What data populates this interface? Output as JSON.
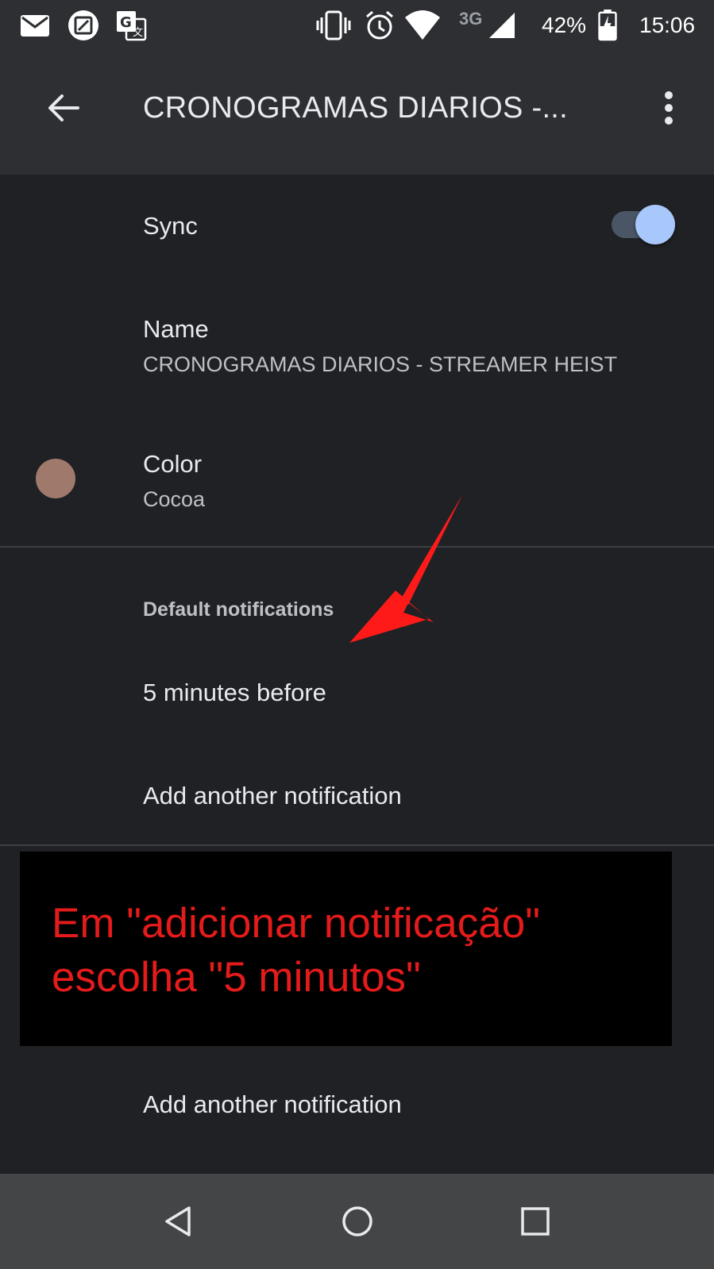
{
  "status_bar": {
    "icons": [
      "mail-icon",
      "screenshot-icon",
      "translate-icon",
      "vibrate-icon",
      "alarm-icon",
      "wifi-icon",
      "signal-icon",
      "battery-charging-icon"
    ],
    "network": "3G",
    "battery": "42%",
    "time": "15:06"
  },
  "app_bar": {
    "back_icon": "arrow-back-icon",
    "title": "CRONOGRAMAS DIARIOS -...",
    "more_icon": "more-vert-icon"
  },
  "settings": {
    "sync": {
      "label": "Sync",
      "enabled": true,
      "accent_color": "#a8c7fa"
    },
    "name": {
      "label": "Name",
      "value": "CRONOGRAMAS DIARIOS - STREAMER HEIST"
    },
    "color": {
      "label": "Color",
      "value": "Cocoa",
      "swatch": "#a0796d"
    },
    "notifications": {
      "header": "Default notifications",
      "items": [
        "5 minutes before"
      ],
      "add_label": "Add another notification"
    },
    "add_label_2": "Add another notification"
  },
  "annotation": {
    "line1": "Em \"adicionar notificação\"",
    "line2": "escolha \"5 minutos\"",
    "text_color": "#e51b1b",
    "arrow_color": "#ff1a1a"
  },
  "nav_bar": {
    "back_icon": "nav-back-icon",
    "home_icon": "nav-home-icon",
    "recents_icon": "nav-recents-icon"
  }
}
